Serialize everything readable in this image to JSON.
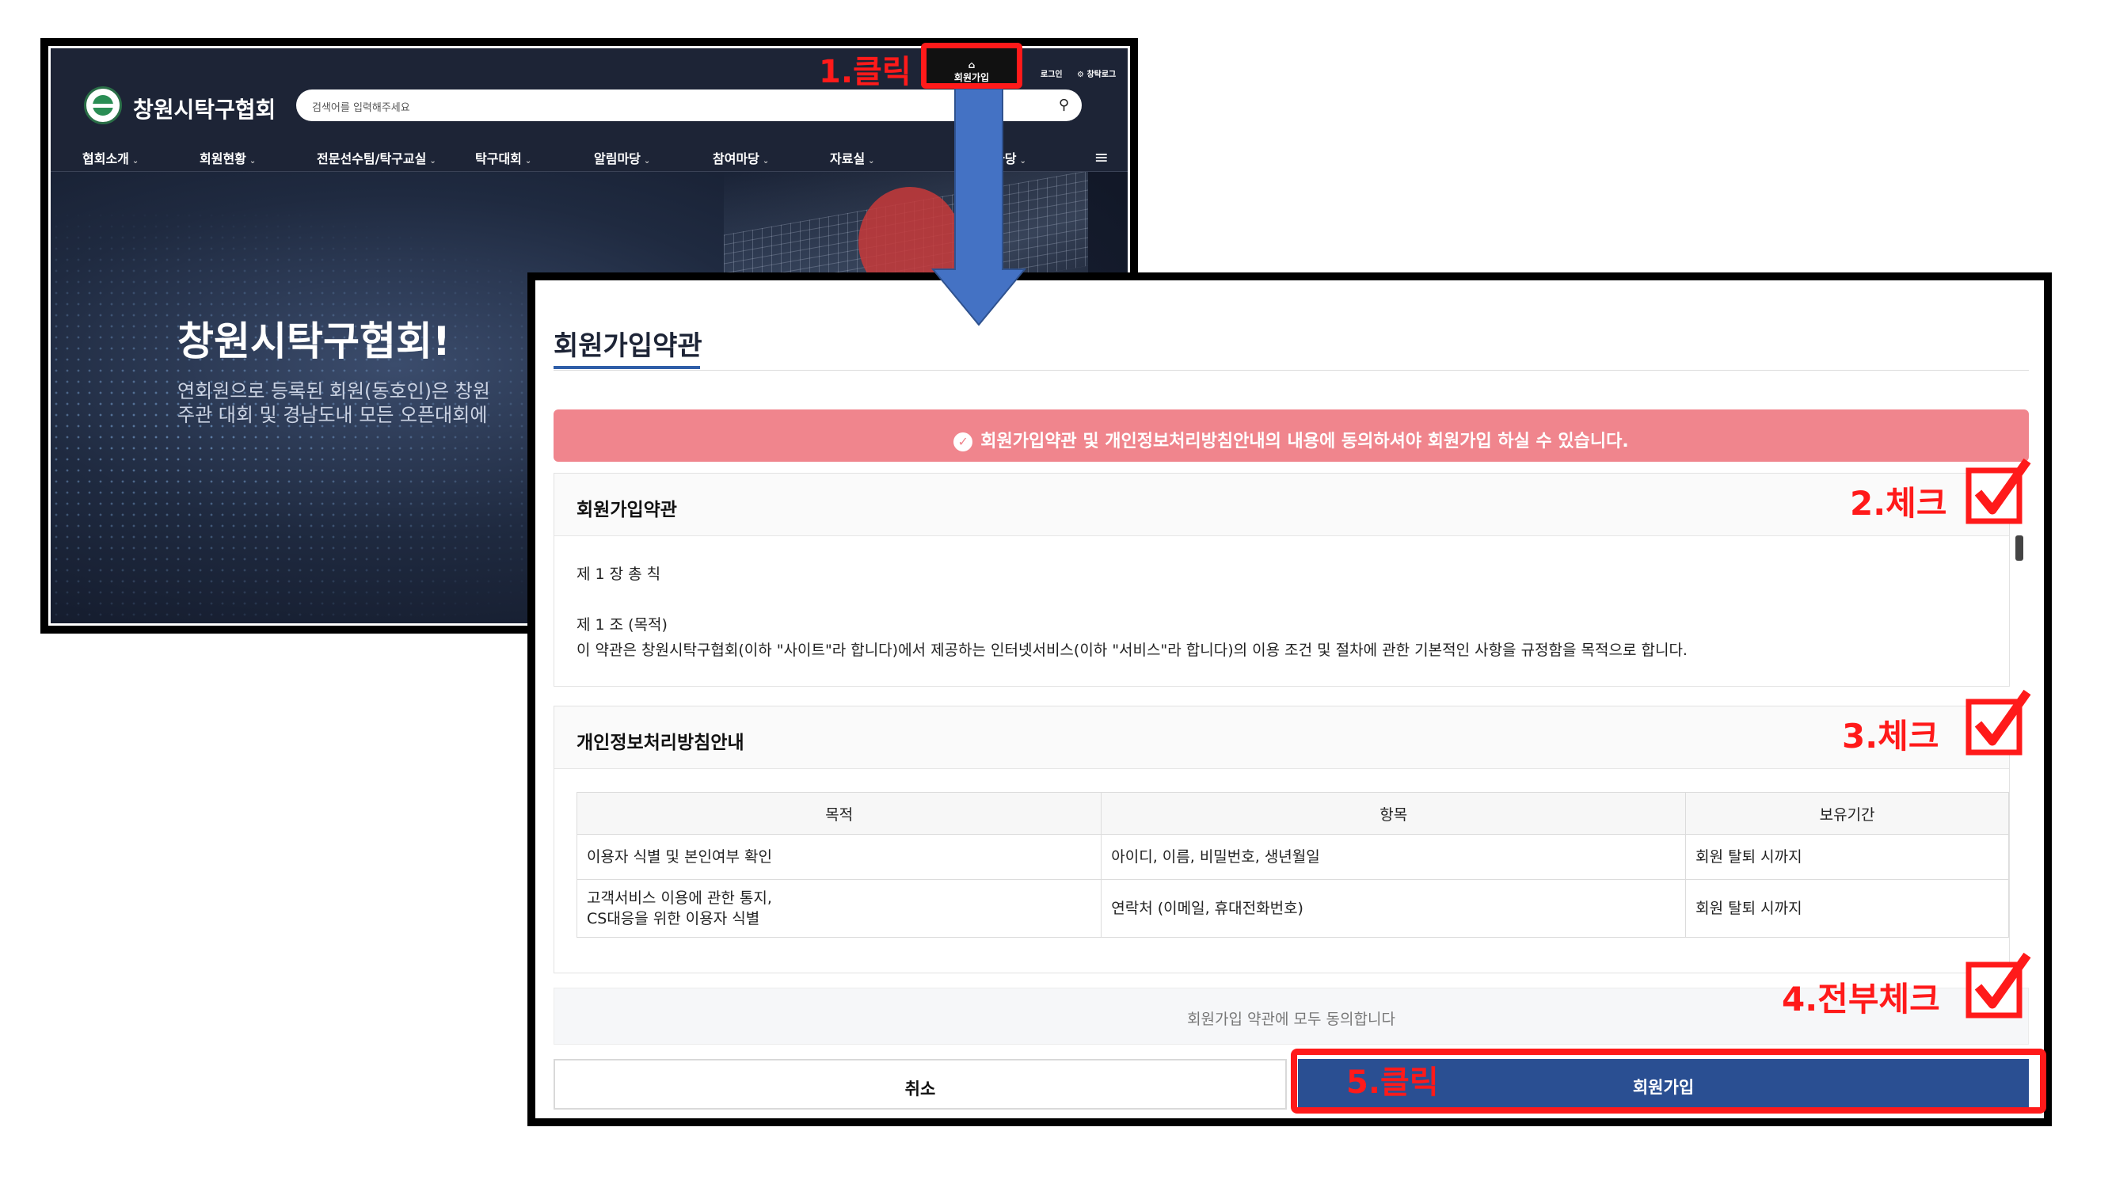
{
  "homepage": {
    "site_name": "창원시탁구협회",
    "search_placeholder": "검색어를 입력해주세요",
    "top_links": [
      "회원가입",
      "로그인",
      "창탁로그"
    ],
    "nav": [
      "협회소개",
      "회원현황",
      "전문선수팀/탁구교실",
      "탁구대회",
      "알림마당",
      "참여마당",
      "자료실",
      "마당"
    ],
    "hero_title": "창원시탁구협회!",
    "hero_lines": [
      "연회원으로 등록된 회원(동호인)은 창원",
      "주관 대회 및 경남도내 모든 오픈대회에"
    ]
  },
  "terms": {
    "page_title": "회원가입약관",
    "alert": "회원가입약관 및 개인정보처리방침안내의 내용에 동의하셔야 회원가입 하실 수 있습니다.",
    "terms_heading": "회원가입약관",
    "terms_lines": [
      "제 1 장 총 칙",
      "제 1 조 (목적)",
      "이 약관은 창원시탁구협회(이하 \"사이트\"라 합니다)에서 제공하는 인터넷서비스(이하 \"서비스\"라 합니다)의 이용 조건 및 절차에 관한 기본적인 사항을 규정함을 목적으로 합니다."
    ],
    "privacy_heading": "개인정보처리방침안내",
    "privacy_table": {
      "headers": [
        "목적",
        "항목",
        "보유기간"
      ],
      "rows": [
        [
          "이용자 식별 및 본인여부 확인",
          "아이디, 이름, 비밀번호, 생년월일",
          "회원 탈퇴 시까지"
        ],
        [
          "고객서비스 이용에 관한 통지,\nCS대응을 위한 이용자 식별",
          "연락처 (이메일, 휴대전화번호)",
          "회원 탈퇴 시까지"
        ]
      ]
    },
    "agree_all": "회원가입 약관에 모두 동의합니다",
    "cancel_label": "취소",
    "join_label": "회원가입"
  },
  "annotations": {
    "step1": "1.클릭",
    "step2": "2.체크",
    "step3": "3.체크",
    "step4": "4.전부체크",
    "step5": "5.클릭",
    "accent_color": "#ff1a1a",
    "arrow_color": "#4472c4"
  }
}
